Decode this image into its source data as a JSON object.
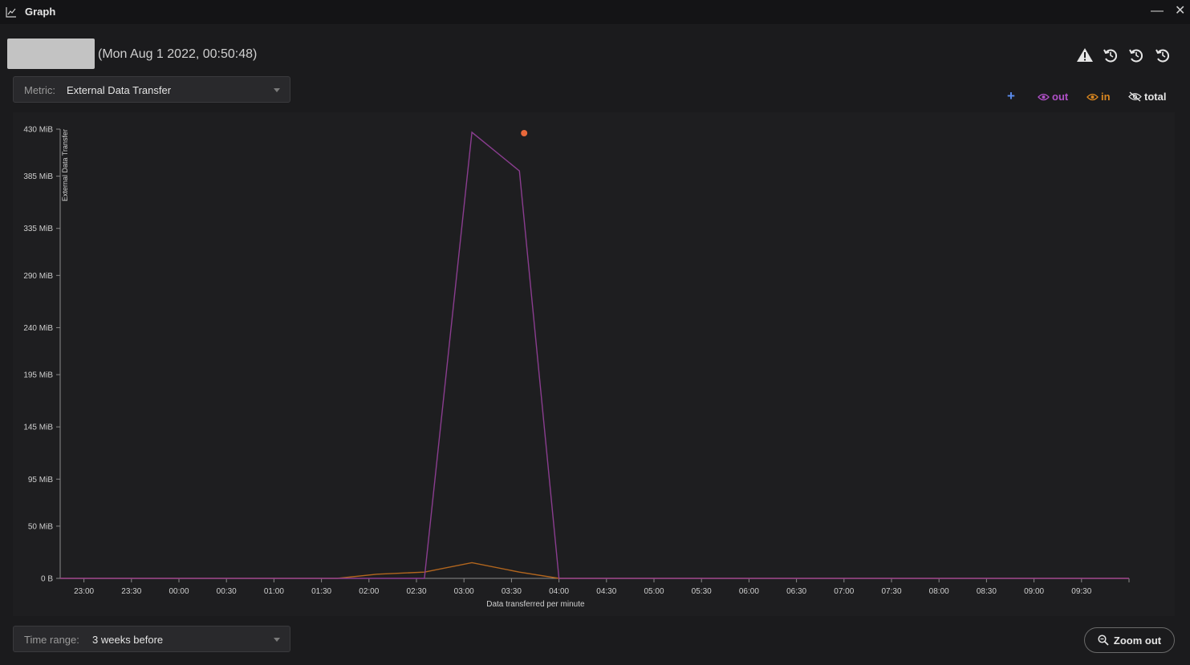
{
  "window": {
    "title": "Graph",
    "minimize_glyph": "—",
    "close_glyph": "✕"
  },
  "header": {
    "timestamp": "(Mon Aug 1 2022, 00:50:48)",
    "icons": [
      "warning-icon",
      "history-icon",
      "history-icon",
      "history-icon"
    ]
  },
  "metric": {
    "label": "Metric:",
    "value": "External Data Transfer"
  },
  "legend": {
    "add": "+",
    "items": [
      {
        "label": "out",
        "color": "#b050c8",
        "visible": true
      },
      {
        "label": "in",
        "color": "#d9861f",
        "visible": true
      },
      {
        "label": "total",
        "color": "#ffffff",
        "visible": false
      }
    ]
  },
  "time_range": {
    "label": "Time range:",
    "value": "3 weeks before"
  },
  "zoom": {
    "label": "Zoom out"
  },
  "colors": {
    "out": "#8a3d8f",
    "in": "#b2661e",
    "marker": "#e8683a",
    "accent": "#5b8def"
  },
  "chart_data": {
    "type": "line",
    "ylabel": "External Data Transfer",
    "xlabel": "Data transferred per minute",
    "y_ticks": [
      "0 B",
      "50 MiB",
      "95 MiB",
      "145 MiB",
      "195 MiB",
      "240 MiB",
      "290 MiB",
      "335 MiB",
      "385 MiB",
      "430 MiB"
    ],
    "y_tick_values": [
      0,
      50,
      95,
      145,
      195,
      240,
      290,
      335,
      385,
      430
    ],
    "ylim": [
      0,
      430
    ],
    "x_ticks": [
      "23:00",
      "23:30",
      "00:00",
      "00:30",
      "01:00",
      "01:30",
      "02:00",
      "02:30",
      "03:00",
      "03:30",
      "04:00",
      "04:30",
      "05:00",
      "05:30",
      "06:00",
      "06:30",
      "07:00",
      "07:30",
      "08:00",
      "08:30",
      "09:00",
      "09:30"
    ],
    "x_unit": "minutes from 23:00",
    "xlim": [
      -15,
      660
    ],
    "series": [
      {
        "name": "out",
        "x": [
          -15,
          155,
          215,
          245,
          275,
          300,
          660
        ],
        "y": [
          0,
          0,
          0,
          427,
          390,
          0,
          0
        ]
      },
      {
        "name": "in",
        "x": [
          -15,
          160,
          185,
          215,
          245,
          275,
          300,
          660
        ],
        "y": [
          0,
          0,
          4,
          6,
          15,
          6,
          0,
          0
        ]
      }
    ],
    "markers": [
      {
        "x": 278,
        "y": 430
      }
    ],
    "grid": false
  }
}
